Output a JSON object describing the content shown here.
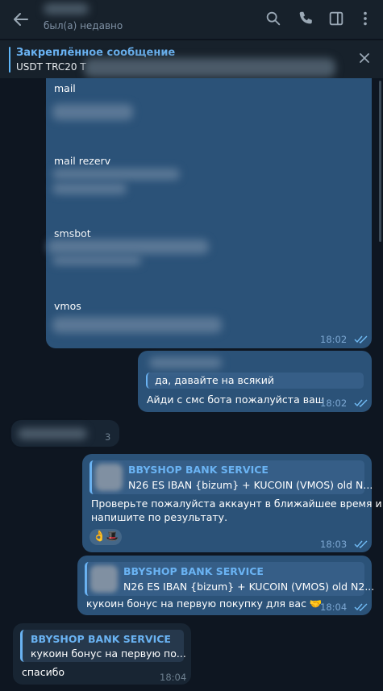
{
  "header": {
    "status": "был(а) недавно"
  },
  "pinned": {
    "title": "Закреплённое сообщение",
    "preview": "USDT TRC20  T"
  },
  "messages": {
    "m1": {
      "labels": [
        "mail",
        "mail rezerv",
        "smsbot",
        "vmos"
      ],
      "time": "18:02"
    },
    "m2": {
      "quote": "да, давайте на всякий",
      "text": "Айди с смс бота пожалуйста ваш",
      "time": "18:02"
    },
    "m3": {
      "time_frag": "3"
    },
    "m4": {
      "reply_title": "BBYSHOP BANK SERVICE",
      "reply_text": "N26 ES IBAN {bizum} + KUCOIN (VMOS) old    N...",
      "text_line1": "Проверьте пожалуйста аккаунт в ближайшее время и",
      "text_line2": "напишите по результату.",
      "reactions": "👌🎩",
      "time": "18:03"
    },
    "m5": {
      "reply_title": "BBYSHOP BANK SERVICE",
      "reply_text": "N26 ES IBAN {bizum} + KUCOIN (VMOS) old    N2...",
      "text": "кукоин бонус на первую покупку для вас 🤝",
      "time": "18:04"
    },
    "m6": {
      "reply_title": "BBYSHOP BANK SERVICE",
      "reply_text": "кукоин бонус на первую по...",
      "text": "спасибо",
      "time": "18:04"
    }
  },
  "colors": {
    "bg": "#0e1621",
    "header": "#17212b",
    "outgoing": "#2b5278",
    "incoming": "#182533",
    "accent": "#6ab3f3"
  }
}
